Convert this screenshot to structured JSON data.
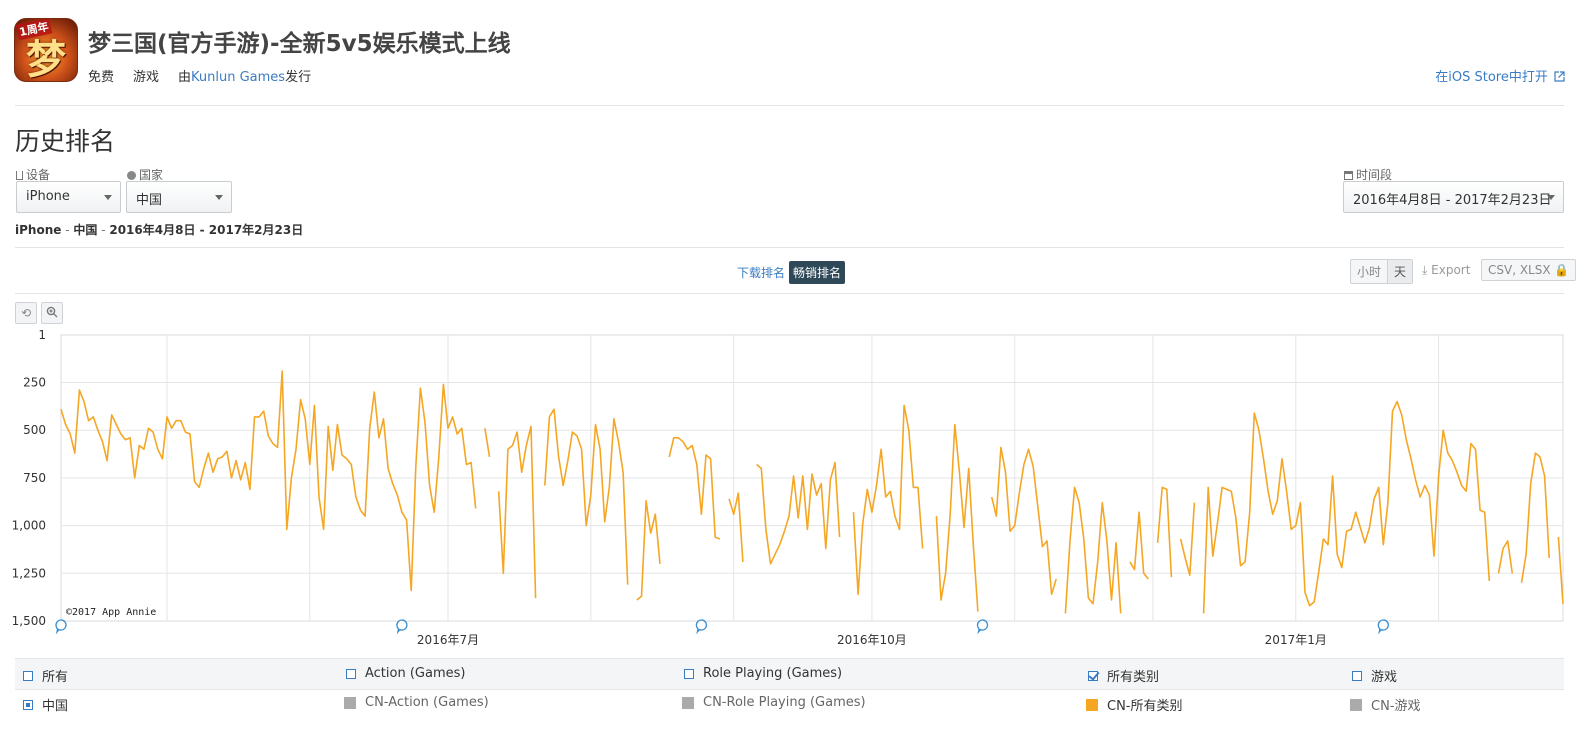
{
  "app": {
    "title": "梦三国(官方手游)-全新5v5娱乐模式上线",
    "price": "免费",
    "category": "游戏",
    "publisher_prefix": "由",
    "publisher": "Kunlun Games",
    "publisher_suffix": "发行",
    "store_link": "在iOS Store中打开",
    "icon_text": "梦",
    "icon_badge": "1周年"
  },
  "section": {
    "title": "历史排名"
  },
  "filters": {
    "device_label": "设备",
    "device_value": "iPhone",
    "country_label": "国家",
    "country_value": "中国",
    "period_label": "时间段",
    "period_value": "2016年4月8日 - 2017年2月23日"
  },
  "breadcrumb": {
    "device": "iPhone",
    "sep1": " - ",
    "country": "中国",
    "sep2": " - ",
    "range": "2016年4月8日 - 2017年2月23日"
  },
  "chart_toolbar": {
    "tab_downloads": "下载排名",
    "tab_grossing": "畅销排名",
    "hour": "小时",
    "day": "天",
    "export": "Export",
    "formats": "CSV, XLSX"
  },
  "chart_data": {
    "type": "line",
    "x_ticks": [
      "2016年7月",
      "2016年10月",
      "2017年1月"
    ],
    "y_ticks": [
      "1",
      "250",
      "500",
      "750",
      "1,000",
      "1,250",
      "1,500"
    ],
    "ylim": [
      1,
      1500
    ],
    "y_inverted": true,
    "watermark": "©2017 App Annie",
    "series": [
      {
        "name": "CN-所有类别",
        "color": "#f5a623",
        "x_start": "2016-04-08",
        "values": [
          390,
          470,
          520,
          620,
          290,
          350,
          450,
          430,
          500,
          560,
          660,
          420,
          470,
          520,
          550,
          540,
          750,
          580,
          600,
          490,
          510,
          600,
          650,
          430,
          490,
          450,
          450,
          510,
          520,
          770,
          800,
          700,
          620,
          720,
          650,
          640,
          610,
          750,
          660,
          760,
          670,
          810,
          430,
          430,
          400,
          530,
          570,
          590,
          190,
          1020,
          750,
          600,
          340,
          440,
          680,
          370,
          850,
          1020,
          480,
          710,
          470,
          630,
          650,
          680,
          850,
          920,
          950,
          490,
          300,
          540,
          440,
          700,
          780,
          840,
          930,
          970,
          1340,
          690,
          280,
          460,
          790,
          930,
          640,
          260,
          490,
          430,
          520,
          490,
          680,
          670,
          910,
          null,
          490,
          640,
          null,
          820,
          1250,
          600,
          580,
          510,
          720,
          580,
          480,
          1380,
          null,
          790,
          430,
          390,
          640,
          790,
          660,
          510,
          530,
          600,
          1000,
          840,
          470,
          600,
          980,
          800,
          440,
          560,
          720,
          1310,
          null,
          1390,
          1370,
          870,
          1040,
          940,
          1200,
          null,
          640,
          540,
          540,
          560,
          600,
          580,
          680,
          940,
          630,
          650,
          1060,
          1070,
          null,
          860,
          940,
          830,
          1190,
          null,
          null,
          680,
          700,
          1020,
          1200,
          1150,
          1100,
          1030,
          950,
          740,
          960,
          740,
          1020,
          730,
          840,
          780,
          1120,
          760,
          670,
          1060,
          null,
          null,
          930,
          1360,
          990,
          810,
          930,
          790,
          600,
          850,
          820,
          950,
          1020,
          370,
          500,
          800,
          800,
          1120,
          null,
          null,
          950,
          1390,
          1250,
          940,
          470,
          720,
          1010,
          700,
          1100,
          1450,
          null,
          null,
          850,
          950,
          590,
          720,
          1030,
          1000,
          830,
          680,
          600,
          690,
          900,
          1110,
          1080,
          1360,
          1280,
          null,
          1460,
          1080,
          800,
          880,
          1070,
          1380,
          1410,
          1190,
          880,
          1080,
          1390,
          1090,
          1460,
          null,
          1190,
          1230,
          930,
          1250,
          1280,
          null,
          1090,
          800,
          810,
          1270,
          null,
          1070,
          1170,
          1260,
          880,
          null,
          1460,
          800,
          1160,
          990,
          800,
          810,
          820,
          960,
          1210,
          1190,
          930,
          410,
          500,
          650,
          820,
          940,
          870,
          650,
          820,
          1020,
          1000,
          880,
          1350,
          1420,
          1400,
          1240,
          1070,
          1100,
          740,
          1150,
          1220,
          1030,
          1020,
          930,
          1010,
          1090,
          1010,
          860,
          800,
          1100,
          880,
          400,
          350,
          420,
          550,
          650,
          760,
          850,
          790,
          840,
          1160,
          740,
          500,
          620,
          660,
          720,
          790,
          820,
          570,
          600,
          920,
          930,
          1290,
          null,
          1250,
          1120,
          1080,
          1250,
          null,
          1300,
          1150,
          780,
          620,
          640,
          740,
          1170,
          null,
          1060,
          1410
        ]
      }
    ]
  },
  "legend": {
    "row1": [
      "所有",
      "Action (Games)",
      "Role Playing (Games)",
      "所有类别",
      "游戏"
    ],
    "row2_country": "中国",
    "row2": [
      "CN-Action (Games)",
      "CN-Role Playing (Games)",
      "CN-所有类别",
      "CN-游戏"
    ],
    "row2_colors": [
      "#aaaaaa",
      "#aaaaaa",
      "#f5a623",
      "#aaaaaa"
    ]
  }
}
